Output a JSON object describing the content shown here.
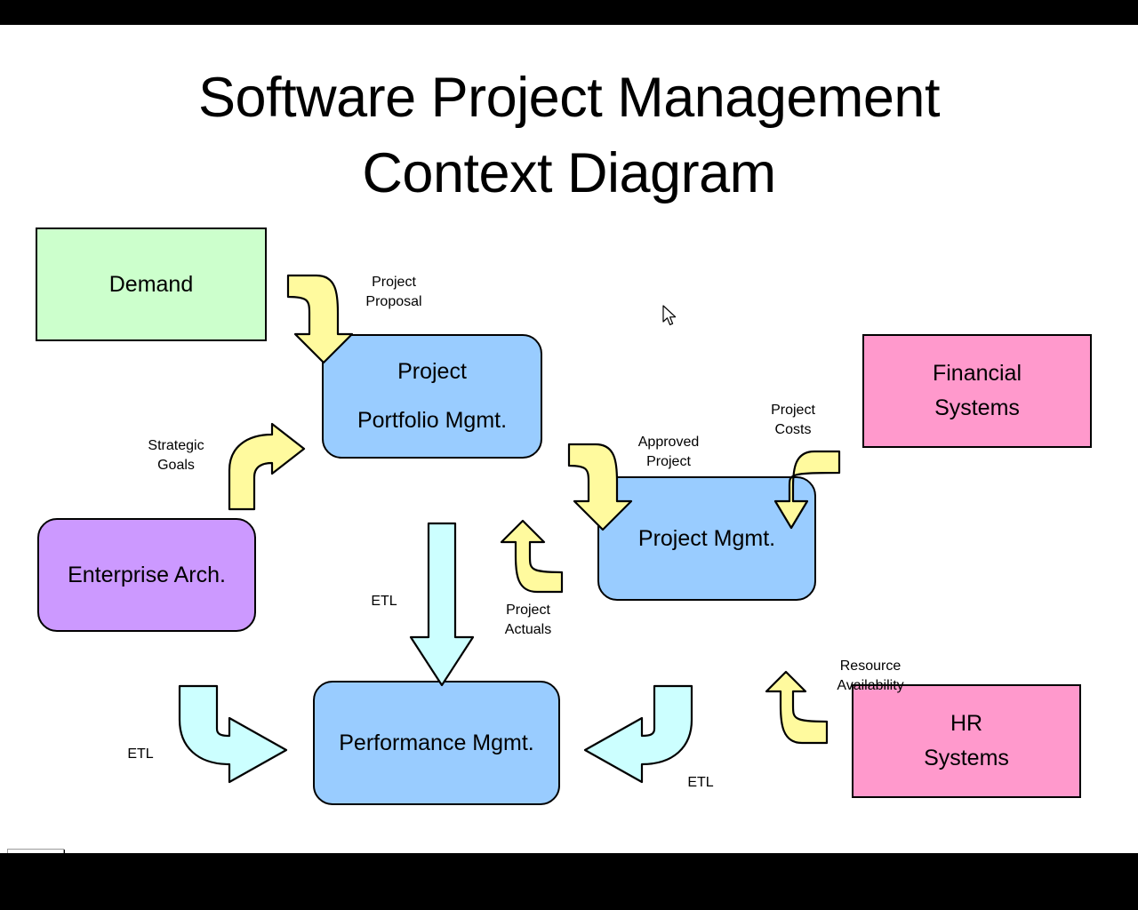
{
  "title": {
    "line1": "Software Project Management",
    "line2": "Context Diagram"
  },
  "nodes": {
    "demand": {
      "label": "Demand",
      "color": "#CCFFCC",
      "shape": "rectangle"
    },
    "ppm_l1": {
      "label": "Project"
    },
    "ppm_l2": {
      "label": "Portfolio Mgmt."
    },
    "ppm_color": {
      "color": "#99CCFF",
      "shape": "rounded"
    },
    "enterprise": {
      "label": "Enterprise Arch.",
      "color": "#CC99FF",
      "shape": "rounded"
    },
    "project_mgmt": {
      "label": "Project Mgmt.",
      "color": "#99CCFF",
      "shape": "rounded"
    },
    "performance": {
      "label": "Performance Mgmt.",
      "color": "#99CCFF",
      "shape": "rounded"
    },
    "financial_l1": {
      "label": "Financial"
    },
    "financial_l2": {
      "label": "Systems"
    },
    "financial_color": {
      "color": "#FF99CC",
      "shape": "rectangle"
    },
    "hr_l1": {
      "label": "HR"
    },
    "hr_l2": {
      "label": "Systems"
    },
    "hr_color": {
      "color": "#FF99CC",
      "shape": "rectangle"
    }
  },
  "flow_labels": {
    "project_proposal_l1": "Project",
    "project_proposal_l2": "Proposal",
    "strategic_goals_l1": "Strategic",
    "strategic_goals_l2": "Goals",
    "approved_project_l1": "Approved",
    "approved_project_l2": "Project",
    "project_costs_l1": "Project",
    "project_costs_l2": "Costs",
    "project_actuals_l1": "Project",
    "project_actuals_l2": "Actuals",
    "resource_avail_l1": "Resource",
    "resource_avail_l2": "Availability",
    "etl_center": "ETL",
    "etl_left": "ETL",
    "etl_right": "ETL"
  },
  "colors": {
    "arrow_yellow": "#FFFA9E",
    "arrow_cyan": "#CCFFFF",
    "green_box": "#CCFFCC",
    "blue_box": "#99CCFF",
    "purple_box": "#CC99FF",
    "pink_box": "#FF99CC",
    "stroke": "#000000",
    "slide_bg": "#FFFFFF",
    "letterbox": "#000000"
  },
  "chart_data": {
    "type": "diagram",
    "title": "Software Project Management Context Diagram",
    "nodes": [
      {
        "id": "demand",
        "label": "Demand",
        "fill": "#CCFFCC",
        "shape": "rectangle"
      },
      {
        "id": "ppm",
        "label": "Project Portfolio Mgmt.",
        "fill": "#99CCFF",
        "shape": "rounded-rectangle"
      },
      {
        "id": "ea",
        "label": "Enterprise Arch.",
        "fill": "#CC99FF",
        "shape": "rounded-rectangle"
      },
      {
        "id": "pm",
        "label": "Project Mgmt.",
        "fill": "#99CCFF",
        "shape": "rounded-rectangle"
      },
      {
        "id": "perf",
        "label": "Performance Mgmt.",
        "fill": "#99CCFF",
        "shape": "rounded-rectangle"
      },
      {
        "id": "fin",
        "label": "Financial Systems",
        "fill": "#FF99CC",
        "shape": "rectangle"
      },
      {
        "id": "hr",
        "label": "HR Systems",
        "fill": "#FF99CC",
        "shape": "rectangle"
      }
    ],
    "edges": [
      {
        "from": "demand",
        "to": "ppm",
        "label": "Project Proposal",
        "arrow_color": "#FFFA9E"
      },
      {
        "from": "ea",
        "to": "ppm",
        "label": "Strategic Goals",
        "arrow_color": "#FFFA9E"
      },
      {
        "from": "ppm",
        "to": "pm",
        "label": "Approved Project",
        "arrow_color": "#FFFA9E"
      },
      {
        "from": "pm",
        "to": "ppm",
        "label": "Project Actuals",
        "arrow_color": "#FFFA9E"
      },
      {
        "from": "fin",
        "to": "pm",
        "label": "Project Costs",
        "arrow_color": "#FFFA9E"
      },
      {
        "from": "hr",
        "to": "pm",
        "label": "Resource Availability",
        "arrow_color": "#FFFA9E"
      },
      {
        "from": "ppm",
        "to": "perf",
        "label": "ETL",
        "arrow_color": "#CCFFFF"
      },
      {
        "from": "ea",
        "to": "perf",
        "label": "ETL",
        "arrow_color": "#CCFFFF"
      },
      {
        "from": "pm",
        "to": "perf",
        "label": "ETL",
        "arrow_color": "#CCFFFF"
      }
    ]
  }
}
